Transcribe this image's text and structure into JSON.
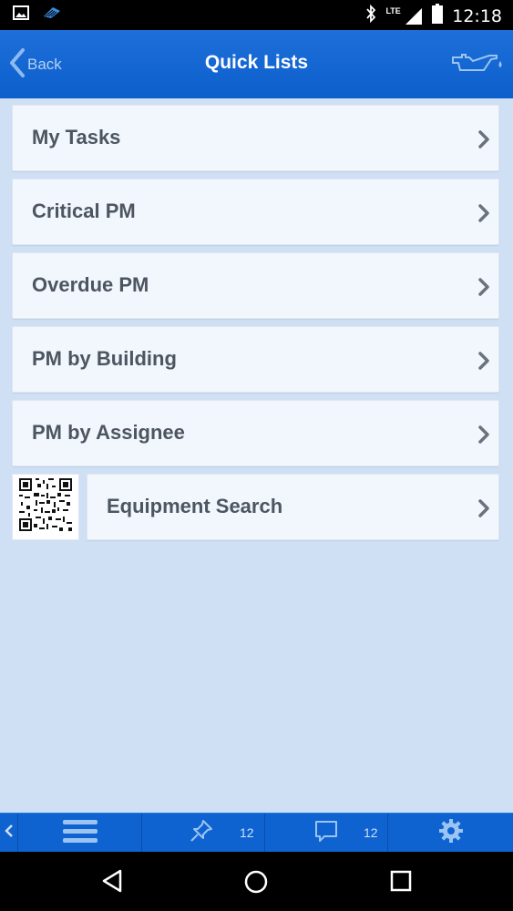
{
  "status_bar": {
    "time": "12:18",
    "network": "LTE"
  },
  "header": {
    "back_label": "Back",
    "title": "Quick Lists"
  },
  "lists": [
    {
      "label": "My Tasks"
    },
    {
      "label": "Critical PM"
    },
    {
      "label": "Overdue PM"
    },
    {
      "label": "PM by Building"
    },
    {
      "label": "PM by Assignee"
    }
  ],
  "equipment_search": {
    "label": "Equipment Search"
  },
  "toolbar": {
    "pins_count": "12",
    "messages_count": "12"
  },
  "colors": {
    "header_blue": "#0c5fcc",
    "background": "#cfe0f5",
    "row_bg": "#f2f6fd",
    "text": "#4d5660"
  }
}
